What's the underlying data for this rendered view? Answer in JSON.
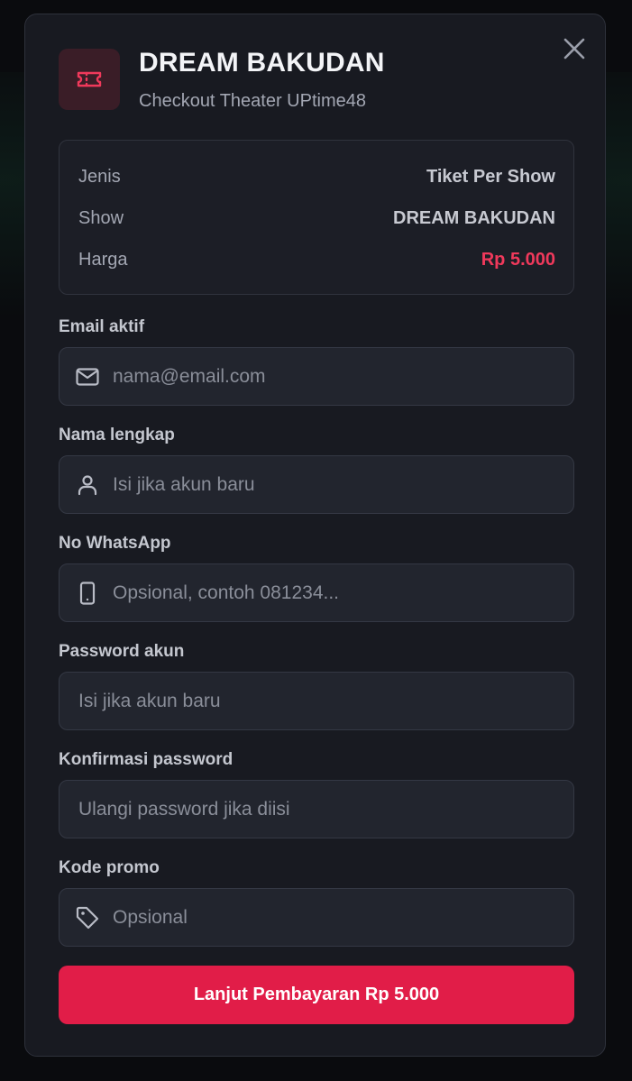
{
  "header": {
    "title": "DREAM BAKUDAN",
    "subtitle": "Checkout Theater UPtime48",
    "icon": "ticket-icon"
  },
  "summary": {
    "rows": [
      {
        "label": "Jenis",
        "value": "Tiket Per Show"
      },
      {
        "label": "Show",
        "value": "DREAM BAKUDAN"
      },
      {
        "label": "Harga",
        "value": "Rp 5.000"
      }
    ]
  },
  "form": {
    "email": {
      "label": "Email aktif",
      "placeholder": "nama@email.com",
      "value": "",
      "icon": "mail-icon"
    },
    "name": {
      "label": "Nama lengkap",
      "placeholder": "Isi jika akun baru",
      "value": "",
      "icon": "user-icon"
    },
    "whatsapp": {
      "label": "No WhatsApp",
      "placeholder": "Opsional, contoh 081234...",
      "value": "",
      "icon": "phone-icon"
    },
    "password": {
      "label": "Password akun",
      "placeholder": "Isi jika akun baru",
      "value": ""
    },
    "confirm_password": {
      "label": "Konfirmasi password",
      "placeholder": "Ulangi password jika diisi",
      "value": ""
    },
    "promo": {
      "label": "Kode promo",
      "placeholder": "Opsional",
      "value": "",
      "icon": "tag-icon"
    }
  },
  "submit": {
    "label": "Lanjut Pembayaran Rp 5.000"
  },
  "colors": {
    "accent": "#e11d48",
    "price": "#f0395b",
    "background": "#0a0b0e",
    "panel": "#181a21"
  }
}
